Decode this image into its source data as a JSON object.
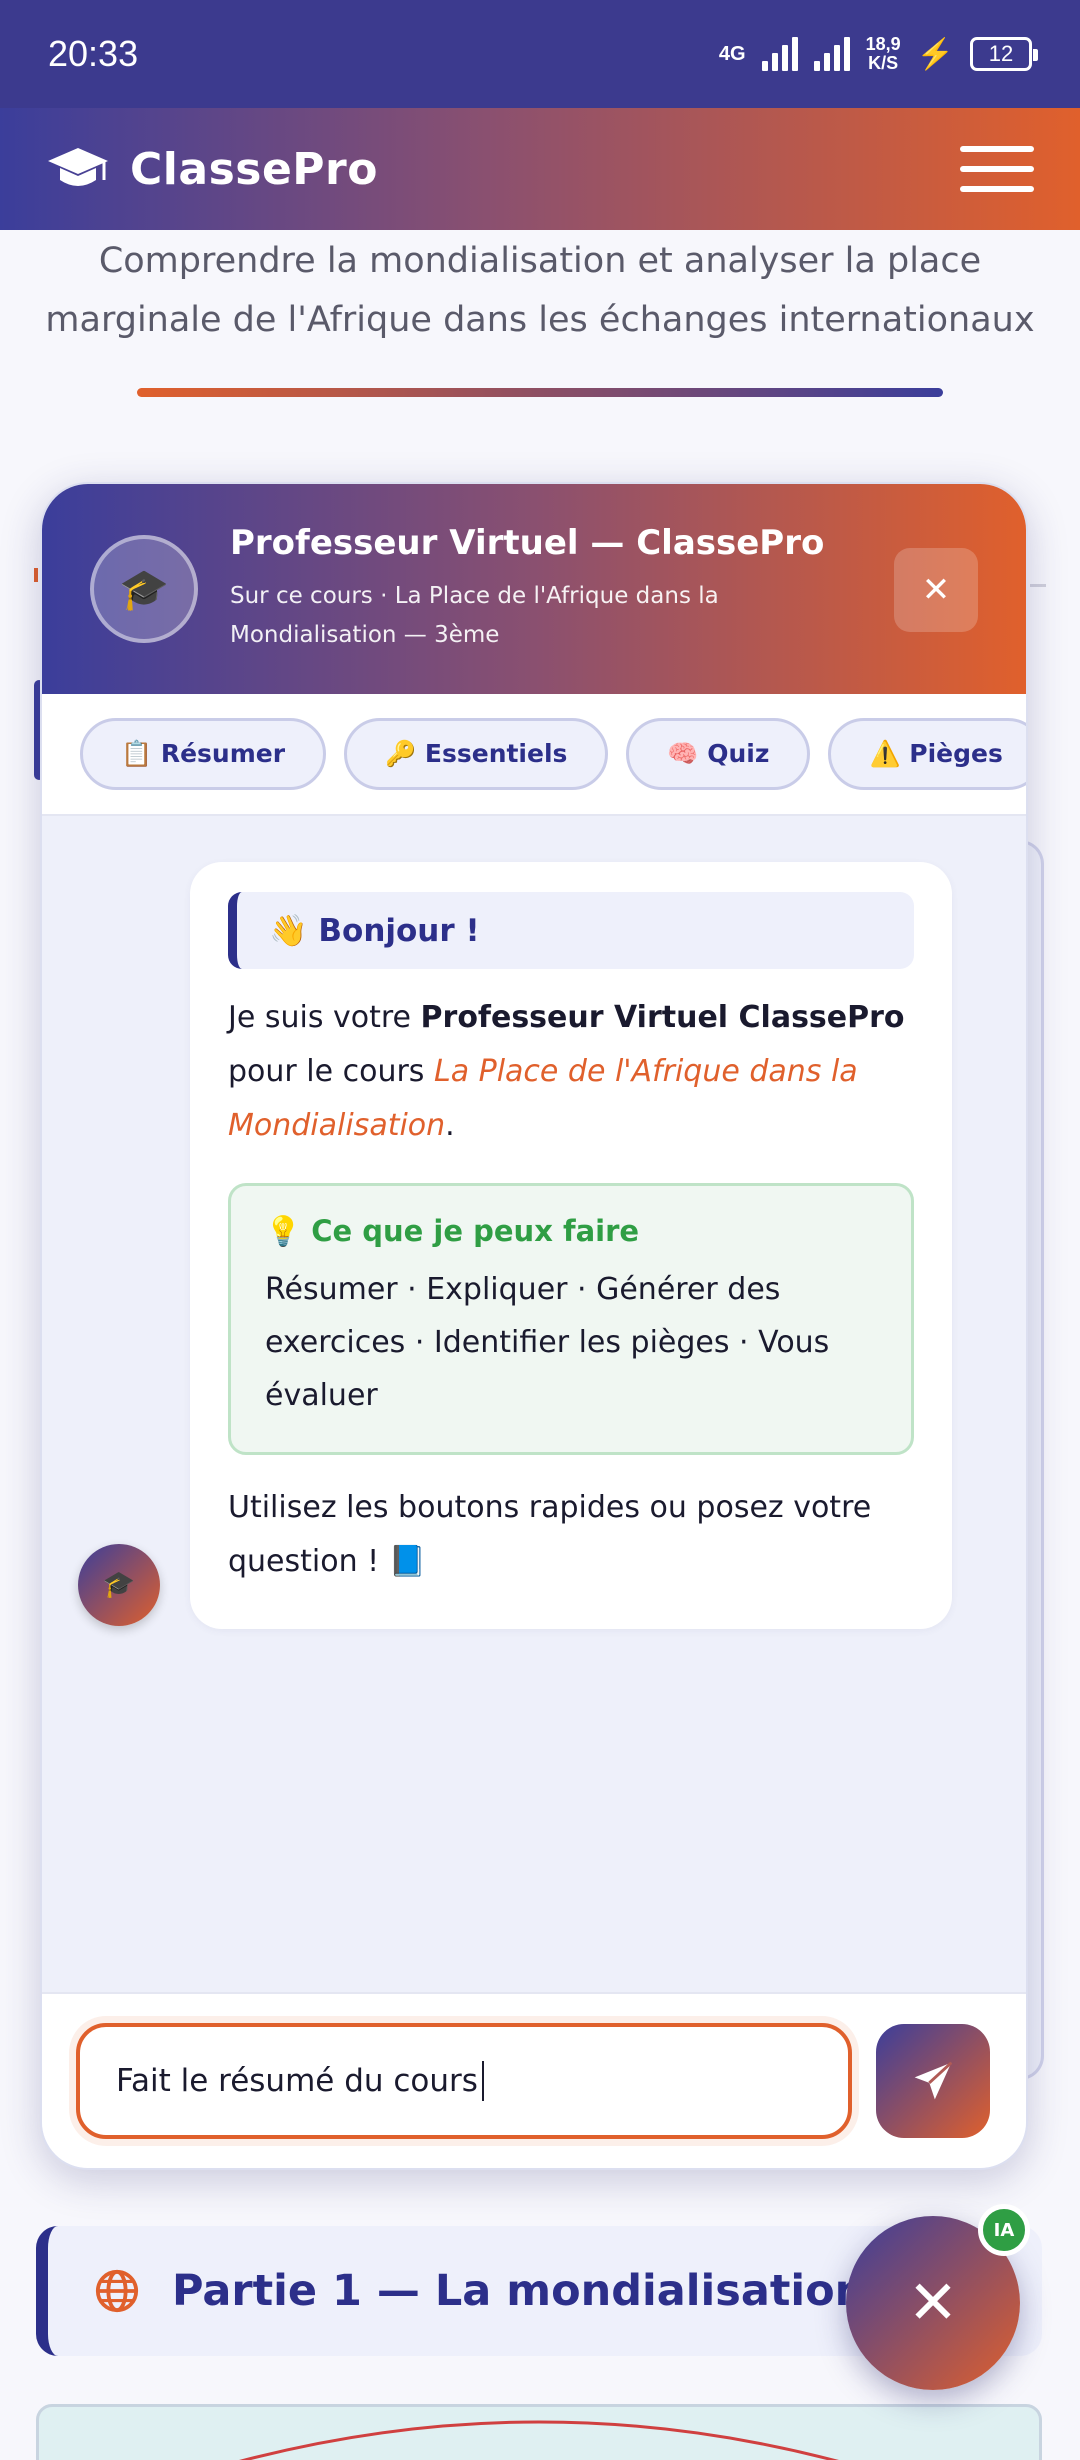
{
  "status_bar": {
    "time": "20:33",
    "network": "4G",
    "speed_top": "18,9",
    "speed_bottom": "K/S",
    "battery": "12"
  },
  "app_bar": {
    "brand": "ClassePro",
    "icon": "graduation-cap-icon"
  },
  "page": {
    "subtitle": "Comprendre la mondialisation et analyser la place marginale de l'Afrique dans les échanges internationaux",
    "section_title": "Partie 1 — La mondialisation"
  },
  "chat": {
    "title": "Professeur Virtuel — ClassePro",
    "subtitle": "Sur ce cours · La Place de l'Afrique dans la Mondialisation — 3ème",
    "avatar_emoji": "🎓",
    "close_symbol": "✕",
    "chips": [
      {
        "label": "📋 Résumer"
      },
      {
        "label": "🔑 Essentiels"
      },
      {
        "label": "🧠 Quiz"
      },
      {
        "label": "⚠️ Pièges"
      },
      {
        "label": "❓"
      }
    ],
    "message": {
      "greeting": "👋 Bonjour !",
      "intro_pre": "Je suis votre ",
      "intro_bold": "Professeur Virtuel ClassePro",
      "intro_mid": " pour le cours ",
      "intro_course": "La Place de l'Afrique dans la Mondialisation",
      "intro_end": ".",
      "capabilities_title": "💡 Ce que je peux faire",
      "capabilities_body": "Résumer · Expliquer · Générer des exercices · Identifier les pièges · Vous évaluer",
      "outro": "Utilisez les boutons rapides ou posez votre question ! 📘"
    },
    "input_value": "Fait le résumé du cours"
  },
  "fab": {
    "symbol": "✕",
    "badge": "IA"
  },
  "colors": {
    "primary": "#2c2f8a",
    "accent": "#e0602c",
    "success": "#2f9e44"
  }
}
